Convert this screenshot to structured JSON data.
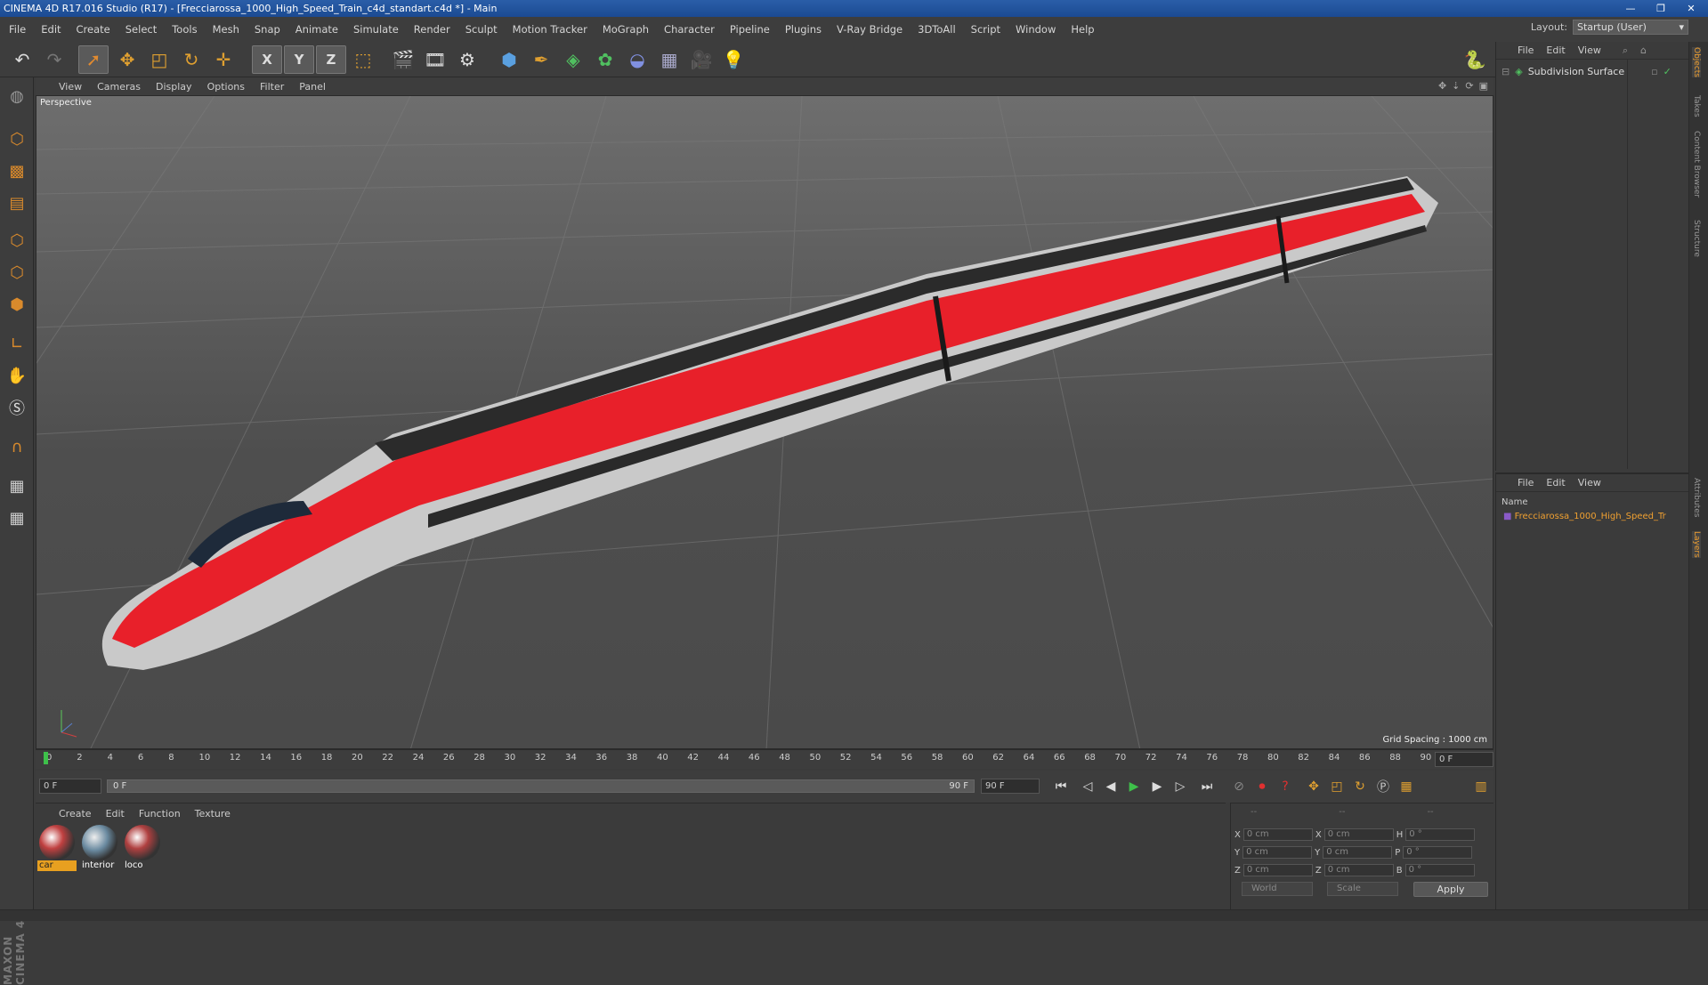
{
  "window": {
    "title": "CINEMA 4D R17.016 Studio (R17) - [Frecciarossa_1000_High_Speed_Train_c4d_standart.c4d *] - Main",
    "controls": [
      "minimize-icon",
      "restore-icon",
      "close-icon"
    ]
  },
  "menubar": {
    "items": [
      "File",
      "Edit",
      "Create",
      "Select",
      "Tools",
      "Mesh",
      "Snap",
      "Animate",
      "Simulate",
      "Render",
      "Sculpt",
      "Motion Tracker",
      "MoGraph",
      "Character",
      "Pipeline",
      "Plugins",
      "V-Ray Bridge",
      "3DToAll",
      "Script",
      "Window",
      "Help"
    ],
    "layout_label": "Layout:",
    "layout_value": "Startup (User)"
  },
  "toolbar": {
    "icons": [
      "undo-icon",
      "redo-icon",
      "live-selection-icon",
      "move-icon",
      "scale-icon",
      "rotate-icon",
      "add-icon",
      "x-axis-icon",
      "y-axis-icon",
      "z-axis-icon",
      "coordinate-system-icon",
      "render-view-icon",
      "render-picture-viewer-icon",
      "edit-render-settings-icon",
      "cube-icon",
      "pen-icon",
      "subdivision-icon",
      "mograph-cloner-icon",
      "deformer-icon",
      "floor-icon",
      "camera-icon",
      "light-icon"
    ],
    "axis_labels": [
      "X",
      "Y",
      "Z"
    ]
  },
  "viewport": {
    "menu": [
      "View",
      "Cameras",
      "Display",
      "Options",
      "Filter",
      "Panel"
    ],
    "label": "Perspective",
    "grid_info": "Grid Spacing : 1000 cm"
  },
  "timeline": {
    "ticks": [
      "0",
      "2",
      "4",
      "6",
      "8",
      "10",
      "12",
      "14",
      "16",
      "18",
      "20",
      "22",
      "24",
      "26",
      "28",
      "30",
      "32",
      "34",
      "36",
      "38",
      "40",
      "42",
      "44",
      "46",
      "48",
      "50",
      "52",
      "54",
      "56",
      "58",
      "60",
      "62",
      "64",
      "66",
      "68",
      "70",
      "72",
      "74",
      "76",
      "78",
      "80",
      "82",
      "84",
      "86",
      "88",
      "90"
    ],
    "current_frame": "0 F"
  },
  "playback": {
    "start": "0 F",
    "slider_start": "0 F",
    "slider_end": "90 F",
    "end": "90 F"
  },
  "materials": {
    "menu": [
      "Create",
      "Edit",
      "Function",
      "Texture"
    ],
    "items": [
      {
        "name": "car",
        "selected": true
      },
      {
        "name": "interior",
        "selected": false
      },
      {
        "name": "loco",
        "selected": false
      }
    ]
  },
  "coordinates": {
    "header": [
      "--",
      "--",
      "--"
    ],
    "rows": [
      {
        "a": "X",
        "av": "0 cm",
        "b": "X",
        "bv": "0 cm",
        "c": "H",
        "cv": "0 °"
      },
      {
        "a": "Y",
        "av": "0 cm",
        "b": "Y",
        "bv": "0 cm",
        "c": "P",
        "cv": "0 °"
      },
      {
        "a": "Z",
        "av": "0 cm",
        "b": "Z",
        "bv": "0 cm",
        "c": "B",
        "cv": "0 °"
      }
    ],
    "mode1": "World",
    "mode2": "Scale",
    "apply": "Apply"
  },
  "objects_panel": {
    "menu": [
      "File",
      "Edit",
      "View"
    ],
    "object": "Subdivision Surface"
  },
  "layers_panel": {
    "menu": [
      "File",
      "Edit",
      "View"
    ],
    "column": "Name",
    "layer": "Frecciarossa_1000_High_Speed_Tr"
  },
  "side_tabs": [
    "Objects",
    "Takes",
    "Content Browser",
    "Structure",
    "Attributes",
    "Layers"
  ],
  "logo": "MAXON CINEMA 4D",
  "colors": {
    "accent": "#f0a030",
    "train_red": "#e8202a",
    "train_silver": "#c8c8c8"
  }
}
